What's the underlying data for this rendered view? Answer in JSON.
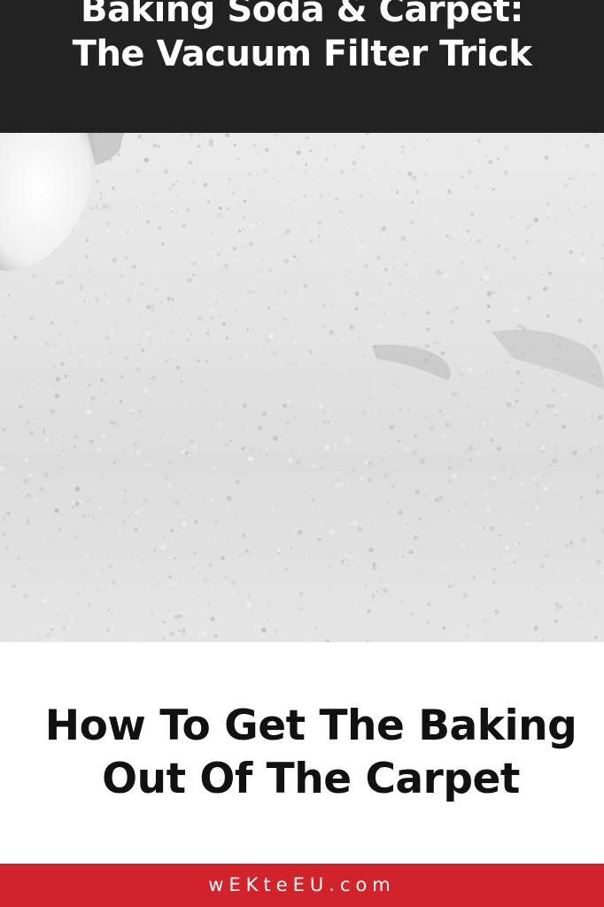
{
  "header": {
    "title_line1": "Baking Soda & Carpet:",
    "title_line2": "The Vacuum Filter Trick",
    "background_color": "#222222"
  },
  "photo": {
    "subject": "baking soda sprinkled over a white carpet with a white container"
  },
  "headline": {
    "line1": "How To Get The Baking",
    "line2": "Out Of The Carpet"
  },
  "footer": {
    "site": "wEKteEU.com",
    "background_color": "#d2232a"
  }
}
